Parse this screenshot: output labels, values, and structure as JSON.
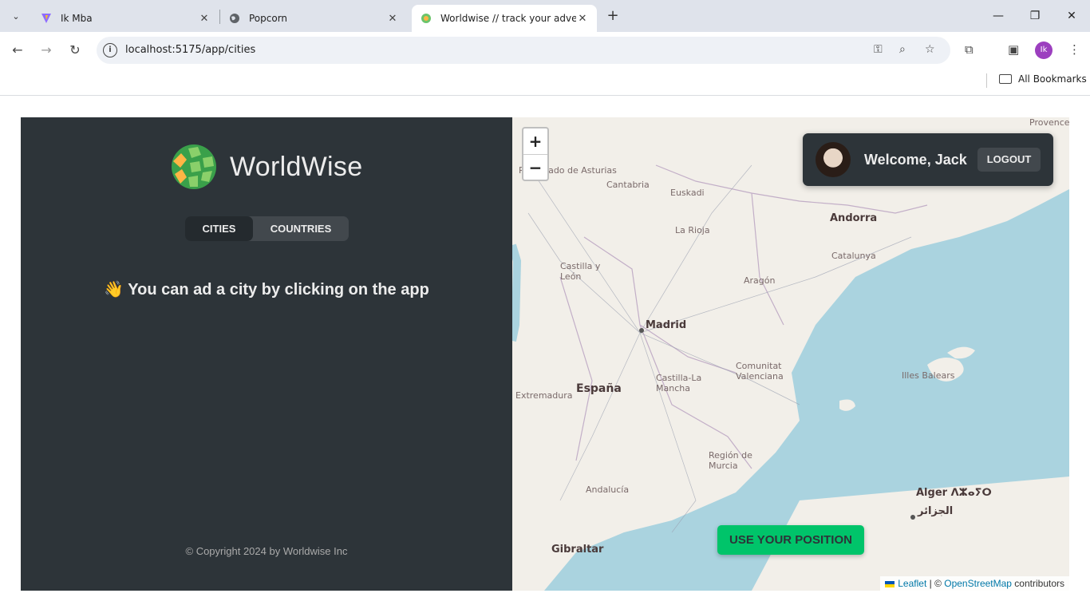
{
  "browser": {
    "tabs": [
      {
        "title": "Ik Mba",
        "favicon": "vite-icon"
      },
      {
        "title": "Popcorn",
        "favicon": "globe-icon"
      },
      {
        "title": "Worldwise // track your adventures",
        "favicon": "worldwise-icon"
      }
    ],
    "url": "localhost:5175/app/cities",
    "profile_initials": "Ik",
    "bookmarks_label": "All Bookmarks"
  },
  "app": {
    "logo_text": "WorldWise",
    "tabs": [
      {
        "label": "Cities",
        "active": true
      },
      {
        "label": "Countries",
        "active": false
      }
    ],
    "message_emoji": "👋",
    "message_text": "You can ad a city by clicking on the app",
    "copyright": "© Copyright 2024 by Worldwise Inc"
  },
  "map": {
    "zoom_in": "+",
    "zoom_out": "−",
    "user": {
      "welcome": "Welcome, Jack",
      "logout": "Logout"
    },
    "use_position": "Use your position",
    "attribution": {
      "leaflet": "Leaflet",
      "sep": " | © ",
      "osm": "OpenStreetMap",
      "suffix": " contributors"
    },
    "labels": [
      {
        "name": "Madrid"
      },
      {
        "name": "España"
      },
      {
        "name": "Andorra"
      },
      {
        "name": "Gibraltar"
      },
      {
        "name": "Alger ⴷⵣⴰⵢⵔ"
      },
      {
        "name": "الجزائر"
      },
      {
        "name": "Illes Balears"
      },
      {
        "name": "Catalunya"
      },
      {
        "name": "Aragón"
      },
      {
        "name": "La Rioja"
      },
      {
        "name": "Euskadi"
      },
      {
        "name": "Cantabria"
      },
      {
        "name": "Castilla y León"
      },
      {
        "name": "Castilla-La Mancha"
      },
      {
        "name": "Comunitat Valenciana"
      },
      {
        "name": "Región de Murcia"
      },
      {
        "name": "Andalucía"
      },
      {
        "name": "Extremadura"
      },
      {
        "name": "Principado de Asturias"
      },
      {
        "name": "Provence"
      }
    ]
  },
  "colors": {
    "sidebar": "#2d3439",
    "accent": "#00c46a",
    "sea": "#aad3df",
    "land": "#f2efe9"
  }
}
